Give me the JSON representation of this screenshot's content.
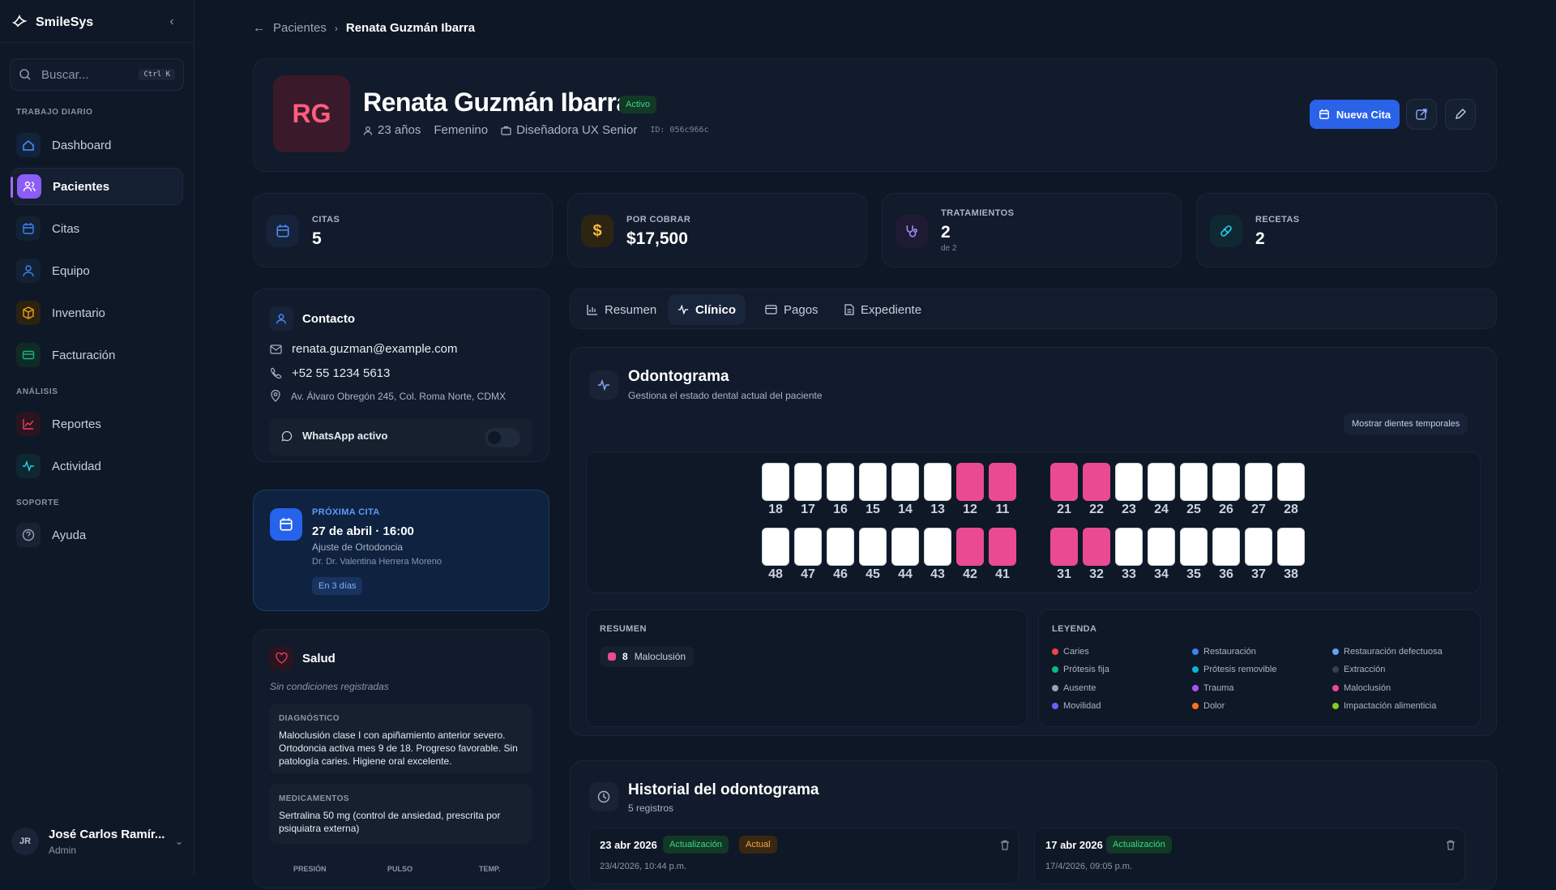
{
  "app": {
    "name": "SmileSys"
  },
  "search": {
    "placeholder": "Buscar...",
    "shortcut": "Ctrl K"
  },
  "sidebar": {
    "sections": [
      "TRABAJO DIARIO",
      "ANÁLISIS",
      "SOPORTE"
    ],
    "items": [
      {
        "label": "Dashboard",
        "color": "#4f8ef7"
      },
      {
        "label": "Pacientes",
        "color": "#a26bf5"
      },
      {
        "label": "Citas",
        "color": "#3b82f6"
      },
      {
        "label": "Equipo",
        "color": "#3b82f6"
      },
      {
        "label": "Inventario",
        "color": "#f59e0b"
      },
      {
        "label": "Facturación",
        "color": "#10b981"
      },
      {
        "label": "Reportes",
        "color": "#f43f5e"
      },
      {
        "label": "Actividad",
        "color": "#22d3ee"
      },
      {
        "label": "Ayuda",
        "color": "#94a3b8"
      }
    ]
  },
  "user": {
    "initials": "JR",
    "name": "José Carlos Ramír...",
    "role": "Admin"
  },
  "breadcrumb": {
    "parent": "Pacientes",
    "current": "Renata Guzmán Ibarra"
  },
  "patient": {
    "initials": "RG",
    "name": "Renata Guzmán Ibarra",
    "status": "Activo",
    "age": "23 años",
    "gender": "Femenino",
    "job": "Diseñadora UX Senior",
    "id": "ID: 056c966c",
    "new_appointment": "Nueva Cita"
  },
  "stats": [
    {
      "label": "CITAS",
      "value": "5",
      "sub": ""
    },
    {
      "label": "POR COBRAR",
      "value": "$17,500",
      "sub": ""
    },
    {
      "label": "TRATAMIENTOS",
      "value": "2",
      "sub": "de 2"
    },
    {
      "label": "RECETAS",
      "value": "2",
      "sub": ""
    }
  ],
  "contact": {
    "title": "Contacto",
    "email": "renata.guzman@example.com",
    "phone": "+52 55 1234 5613",
    "address": "Av. Álvaro Obregón 245, Col. Roma Norte, CDMX",
    "whatsapp": "WhatsApp activo",
    "whatsapp_on": false
  },
  "next_appointment": {
    "label": "PRÓXIMA CITA",
    "datetime": "27 de abril · 16:00",
    "type": "Ajuste de Ortodoncia",
    "doctor": "Dr. Dr. Valentina Herrera Moreno",
    "badge": "En 3 días"
  },
  "health": {
    "title": "Salud",
    "note": "Sin condiciones registradas",
    "diagnosis_label": "DIAGNÓSTICO",
    "diagnosis": "Maloclusión clase I con apiñamiento anterior severo. Ortodoncia activa mes 9 de 18. Progreso favorable. Sin patología caries. Higiene oral excelente.",
    "meds_label": "MEDICAMENTOS",
    "meds": "Sertralina 50 mg (control de ansiedad, prescrita por psiquiatra externa)",
    "vitals": [
      "PRESIÓN",
      "PULSO",
      "TEMP."
    ]
  },
  "tabs": [
    "Resumen",
    "Clínico",
    "Pagos",
    "Expediente"
  ],
  "odontogram": {
    "title": "Odontograma",
    "subtitle": "Gestiona el estado dental actual del paciente",
    "toggle_temp": "Mostrar dientes temporales",
    "upper": [
      {
        "n": "18",
        "c": "sano"
      },
      {
        "n": "17",
        "c": "sano"
      },
      {
        "n": "16",
        "c": "sano"
      },
      {
        "n": "15",
        "c": "sano"
      },
      {
        "n": "14",
        "c": "sano"
      },
      {
        "n": "13",
        "c": "sano"
      },
      {
        "n": "12",
        "c": "maloclusion"
      },
      {
        "n": "11",
        "c": "maloclusion"
      },
      {
        "n": "21",
        "c": "maloclusion"
      },
      {
        "n": "22",
        "c": "maloclusion"
      },
      {
        "n": "23",
        "c": "sano"
      },
      {
        "n": "24",
        "c": "sano"
      },
      {
        "n": "25",
        "c": "sano"
      },
      {
        "n": "26",
        "c": "sano"
      },
      {
        "n": "27",
        "c": "sano"
      },
      {
        "n": "28",
        "c": "sano"
      }
    ],
    "lower": [
      {
        "n": "48",
        "c": "sano"
      },
      {
        "n": "47",
        "c": "sano"
      },
      {
        "n": "46",
        "c": "sano"
      },
      {
        "n": "45",
        "c": "sano"
      },
      {
        "n": "44",
        "c": "sano"
      },
      {
        "n": "43",
        "c": "sano"
      },
      {
        "n": "42",
        "c": "maloclusion"
      },
      {
        "n": "41",
        "c": "maloclusion"
      },
      {
        "n": "31",
        "c": "maloclusion"
      },
      {
        "n": "32",
        "c": "maloclusion"
      },
      {
        "n": "33",
        "c": "sano"
      },
      {
        "n": "34",
        "c": "sano"
      },
      {
        "n": "35",
        "c": "sano"
      },
      {
        "n": "36",
        "c": "sano"
      },
      {
        "n": "37",
        "c": "sano"
      },
      {
        "n": "38",
        "c": "sano"
      }
    ],
    "summary_label": "RESUMEN",
    "summary_count": "8",
    "summary_item": "Maloclusión",
    "legend_label": "LEYENDA",
    "legend": [
      {
        "label": "Caries",
        "color": "#ef4444"
      },
      {
        "label": "Restauración",
        "color": "#3b82f6"
      },
      {
        "label": "Restauración defectuosa",
        "color": "#60a5fa"
      },
      {
        "label": "Prótesis fija",
        "color": "#10b981"
      },
      {
        "label": "Prótesis removible",
        "color": "#06b6d4"
      },
      {
        "label": "Extracción",
        "color": "#334155"
      },
      {
        "label": "Ausente",
        "color": "#94a3b8"
      },
      {
        "label": "Trauma",
        "color": "#a855f7"
      },
      {
        "label": "Maloclusión",
        "color": "#ec4899"
      },
      {
        "label": "Movilidad",
        "color": "#6366f1"
      },
      {
        "label": "Dolor",
        "color": "#f97316"
      },
      {
        "label": "Impactación alimenticia",
        "color": "#84cc16"
      }
    ]
  },
  "history": {
    "title": "Historial del odontograma",
    "count": "5 registros",
    "entries": [
      {
        "date": "23 abr 2026",
        "type": "Actualización",
        "current": "Actual",
        "time": "23/4/2026, 10:44 p.m."
      },
      {
        "date": "17 abr 2026",
        "type": "Actualización",
        "current": "",
        "time": "17/4/2026, 09:05 p.m."
      }
    ]
  }
}
